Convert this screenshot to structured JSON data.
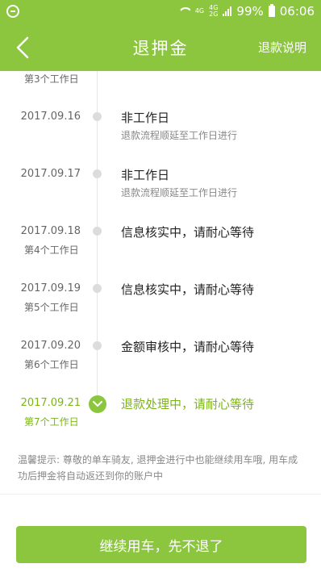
{
  "status_bar": {
    "net_top": "4G",
    "net_mid": "4G",
    "net_bottom": "2G",
    "battery": "99%",
    "time": "06:06",
    "icons": [
      "minus-circle-icon",
      "wifi-icon",
      "signal-icon",
      "battery-icon"
    ]
  },
  "header": {
    "title": "退押金",
    "right_link": "退款说明",
    "back_icon": "chevron-left-icon"
  },
  "timeline": {
    "top_fragment": "第3个工作日",
    "items": [
      {
        "date": "2017.09.16",
        "day": "",
        "title": "非工作日",
        "subtitle": "退款流程顺延至工作日进行",
        "active": false
      },
      {
        "date": "2017.09.17",
        "day": "",
        "title": "非工作日",
        "subtitle": "退款流程顺延至工作日进行",
        "active": false
      },
      {
        "date": "2017.09.18",
        "day": "第4个工作日",
        "title": "信息核实中，请耐心等待",
        "subtitle": "",
        "active": false
      },
      {
        "date": "2017.09.19",
        "day": "第5个工作日",
        "title": "信息核实中，请耐心等待",
        "subtitle": "",
        "active": false
      },
      {
        "date": "2017.09.20",
        "day": "第6个工作日",
        "title": "金额审核中，请耐心等待",
        "subtitle": "",
        "active": false
      },
      {
        "date": "2017.09.21",
        "day": "第7个工作日",
        "title": "退款处理中，请耐心等待",
        "subtitle": "",
        "active": true
      }
    ]
  },
  "tip": "温馨提示: 尊敬的单车骑友, 退押金进行中也能继续用车哦, 用车成功后押金将自动返还到你的账户中",
  "bottom_button": "继续用车，先不退了",
  "colors": {
    "accent": "#8cc63f",
    "active_text": "#7cb518",
    "dot": "#dcdcdc"
  }
}
